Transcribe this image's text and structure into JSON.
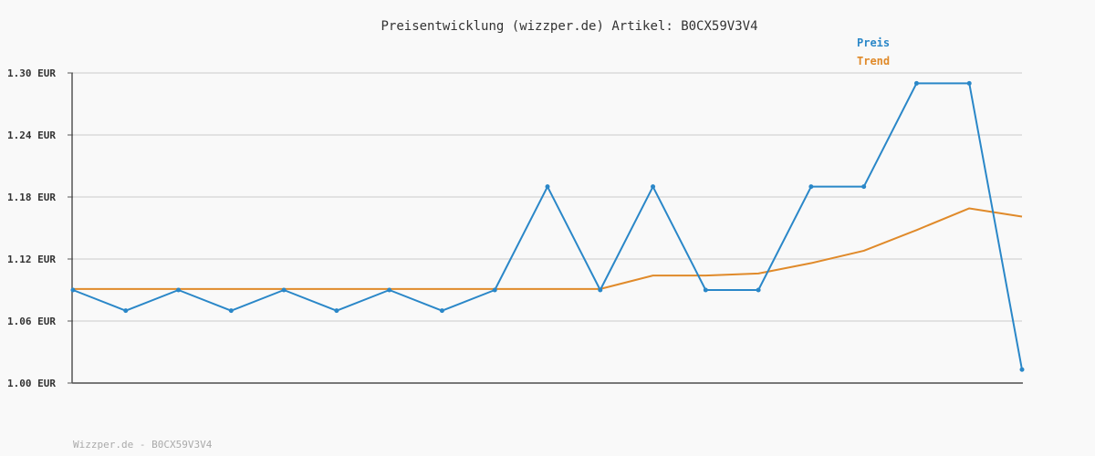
{
  "chart_data": {
    "type": "line",
    "title": "Preisentwicklung (wizzper.de) Artikel: B0CX59V3V4",
    "footer": "Wizzper.de - B0CX59V3V4",
    "ylim": [
      1.0,
      1.3
    ],
    "yticks": [
      1.0,
      1.06,
      1.12,
      1.18,
      1.24,
      1.3
    ],
    "ytick_labels": [
      "1.00 EUR",
      "1.06 EUR",
      "1.12 EUR",
      "1.18 EUR",
      "1.24 EUR",
      "1.30 EUR"
    ],
    "grid": true,
    "legend_position": "top-right",
    "x": [
      1,
      2,
      3,
      4,
      5,
      6,
      7,
      8,
      9,
      10,
      11,
      12,
      13,
      14,
      15,
      16,
      17,
      18,
      19
    ],
    "series": [
      {
        "name": "Preis",
        "color": "#2a87c8",
        "values": [
          1.09,
          1.07,
          1.09,
          1.07,
          1.09,
          1.07,
          1.09,
          1.07,
          1.09,
          1.19,
          1.09,
          1.19,
          1.09,
          1.09,
          1.19,
          1.19,
          1.29,
          1.29,
          1.013
        ],
        "markers": true
      },
      {
        "name": "Trend",
        "color": "#e08a2a",
        "values": [
          1.091,
          1.091,
          1.091,
          1.091,
          1.091,
          1.091,
          1.091,
          1.091,
          1.091,
          1.091,
          1.091,
          1.104,
          1.104,
          1.106,
          1.116,
          1.128,
          1.148,
          1.169,
          1.161
        ],
        "markers": false
      }
    ]
  }
}
